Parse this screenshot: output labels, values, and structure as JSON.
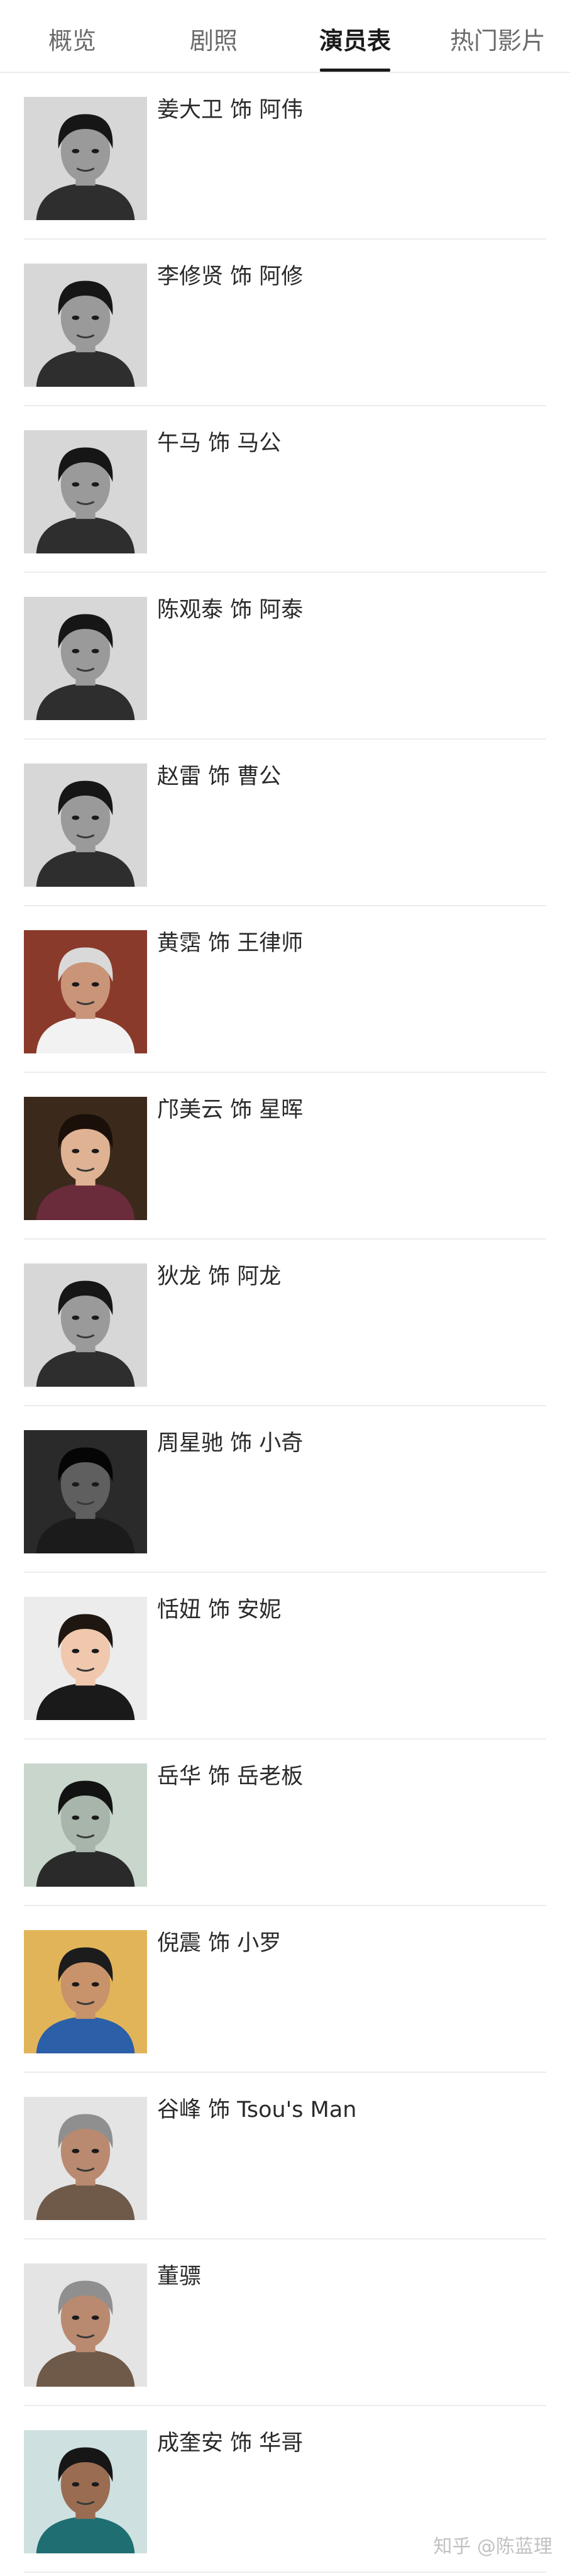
{
  "tabs": [
    {
      "label": "概览",
      "active": false
    },
    {
      "label": "剧照",
      "active": false
    },
    {
      "label": "演员表",
      "active": true
    },
    {
      "label": "热门影片",
      "active": false
    }
  ],
  "cast": [
    {
      "name": "姜大卫 饰 阿伟",
      "photo": "bw"
    },
    {
      "name": "李修贤 饰 阿修",
      "photo": "bw"
    },
    {
      "name": "午马 饰 马公",
      "photo": "bw"
    },
    {
      "name": "陈观泰 饰 阿泰",
      "photo": "bw"
    },
    {
      "name": "赵雷 饰 曹公",
      "photo": "bw"
    },
    {
      "name": "黄霑 饰 王律师",
      "photo": "color-red"
    },
    {
      "name": "邝美云 饰 星晖",
      "photo": "color-warm"
    },
    {
      "name": "狄龙 饰 阿龙",
      "photo": "bw"
    },
    {
      "name": "周星驰 饰 小奇",
      "photo": "dark"
    },
    {
      "name": "恬妞 饰 安妮",
      "photo": "color-light"
    },
    {
      "name": "岳华 饰 岳老板",
      "photo": "bw-green"
    },
    {
      "name": "倪震 饰 小罗",
      "photo": "color-gold"
    },
    {
      "name": "谷峰 饰 Tsou's Man",
      "photo": "color-neutral"
    },
    {
      "name": "董骠",
      "photo": "color-neutral"
    },
    {
      "name": "成奎安 饰 华哥",
      "photo": "color-teal"
    }
  ],
  "watermark": "知乎 @陈蓝理"
}
